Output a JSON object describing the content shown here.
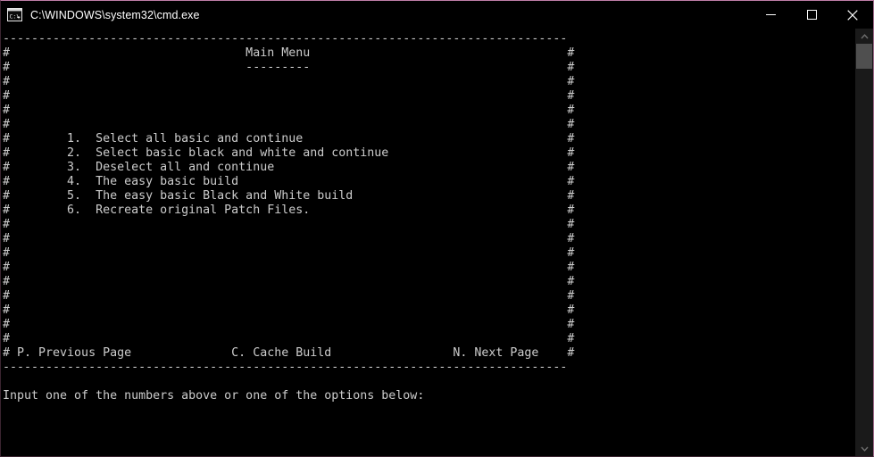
{
  "window": {
    "title": "C:\\WINDOWS\\system32\\cmd.exe",
    "icon": "cmd-prompt-icon",
    "controls": {
      "minimize": "minimize-icon",
      "maximize": "maximize-icon",
      "close": "close-icon"
    },
    "colors": {
      "background": "#000000",
      "text": "#cccccc",
      "titlebar_text": "#ffffff",
      "border_accent": "#c07fa8",
      "scrollbar_track": "#1a1a1a",
      "scrollbar_thumb": "#4f4f4f"
    }
  },
  "terminal": {
    "border_char": "#",
    "rule": "------------------------------------------------------------------------------",
    "heading": "Main Menu",
    "heading_underline": "---------",
    "menu_items": [
      {
        "key": "1.",
        "label": "Select all basic and continue"
      },
      {
        "key": "2.",
        "label": "Select basic black and white and continue"
      },
      {
        "key": "3.",
        "label": "Deselect all and continue"
      },
      {
        "key": "4.",
        "label": "The easy basic build"
      },
      {
        "key": "5.",
        "label": "The easy basic Black and White build"
      },
      {
        "key": "6.",
        "label": "Recreate original Patch Files."
      }
    ],
    "nav": {
      "previous": "P. Previous Page",
      "cache": "C. Cache Build",
      "next": "N. Next Page"
    },
    "prompt": "Input one of the numbers above or one of the options below:",
    "lines": [
      "-------------------------------------------------------------------------------",
      "#                                 Main Menu                                    #",
      "#                                 ---------                                    #",
      "#                                                                              #",
      "#                                                                              #",
      "#                                                                              #",
      "#                                                                              #",
      "#        1.  Select all basic and continue                                     #",
      "#        2.  Select basic black and white and continue                         #",
      "#        3.  Deselect all and continue                                         #",
      "#        4.  The easy basic build                                              #",
      "#        5.  The easy basic Black and White build                              #",
      "#        6.  Recreate original Patch Files.                                    #",
      "#                                                                              #",
      "#                                                                              #",
      "#                                                                              #",
      "#                                                                              #",
      "#                                                                              #",
      "#                                                                              #",
      "#                                                                              #",
      "#                                                                              #",
      "#                                                                              #",
      "# P. Previous Page              C. Cache Build                 N. Next Page    #",
      "-------------------------------------------------------------------------------",
      "",
      "Input one of the numbers above or one of the options below:"
    ]
  }
}
